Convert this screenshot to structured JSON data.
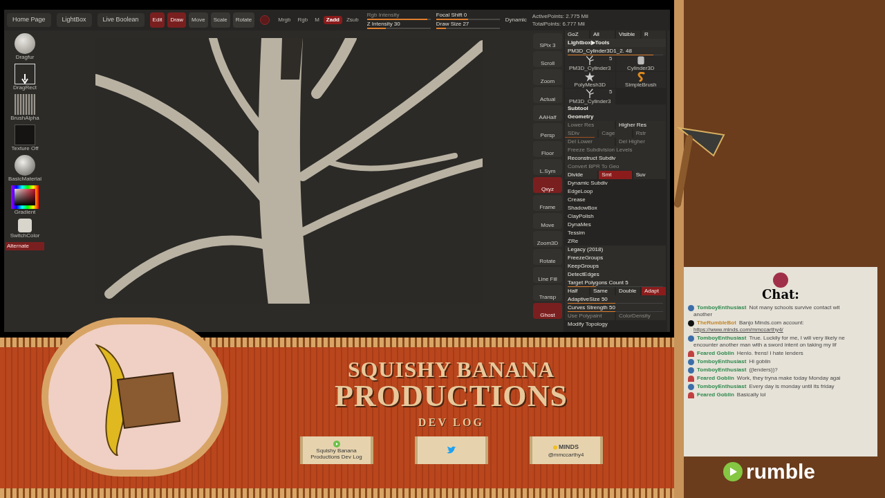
{
  "top_bar": [
    {
      "kind": "tab",
      "label": "Home Page"
    },
    {
      "kind": "tab",
      "label": "LightBox"
    },
    {
      "kind": "tab",
      "label": "Live Boolean"
    },
    {
      "kind": "tool",
      "label": "Edit",
      "selected": true
    },
    {
      "kind": "tool",
      "label": "Draw",
      "selected": true
    },
    {
      "kind": "tool",
      "label": "Move",
      "selected": false
    },
    {
      "kind": "tool",
      "label": "Scale",
      "selected": false
    },
    {
      "kind": "tool",
      "label": "Rotate",
      "selected": false
    },
    {
      "kind": "mode",
      "label": "Mrgb",
      "selected": false
    },
    {
      "kind": "mode",
      "label": "Rgb",
      "selected": false
    },
    {
      "kind": "mode",
      "label": "M",
      "selected": false
    },
    {
      "kind": "mode",
      "label": "Zadd",
      "selected": true
    },
    {
      "kind": "mode",
      "label": "Zsub",
      "selected": false
    },
    {
      "kind": "slider",
      "label": "Rgb Intensity",
      "level": 0.95,
      "disabled": true
    },
    {
      "kind": "slider",
      "label": "Z Intensity 30",
      "level": 0.3,
      "disabled": false
    },
    {
      "kind": "slider",
      "label": "Focal Shift 0",
      "level": 0.5,
      "disabled": false
    },
    {
      "kind": "slider",
      "label": "Draw Size 27",
      "level": 0.15,
      "disabled": false
    },
    {
      "kind": "tab",
      "label": "Dynamic"
    },
    {
      "kind": "stat",
      "label": "ActivePoints: 2.775 Mil"
    },
    {
      "kind": "stat",
      "label": "TotalPoints: 6.777 Mil"
    }
  ],
  "shelf": [
    {
      "kind": "brush",
      "label": "Dragfur"
    },
    {
      "kind": "stroke",
      "label": "DragRect"
    },
    {
      "kind": "alpha",
      "label": "BrushAlpha"
    },
    {
      "kind": "texture",
      "label": "Texture Off"
    },
    {
      "kind": "material",
      "label": "BasicMaterial"
    },
    {
      "kind": "color",
      "label": "Gradient"
    },
    {
      "kind": "swatch",
      "label": "SwitchColor"
    },
    {
      "kind": "button",
      "label": "Alternate",
      "selected": true
    }
  ],
  "right_icons": [
    {
      "label": "SPix 3",
      "selected": false
    },
    {
      "label": "Scroll",
      "selected": false
    },
    {
      "label": "Zoom",
      "selected": false
    },
    {
      "label": "Actual",
      "selected": false
    },
    {
      "label": "AAHalf",
      "selected": false
    },
    {
      "label": "Persp",
      "selected": false
    },
    {
      "label": "Floor",
      "selected": false
    },
    {
      "label": "L.Sym",
      "selected": false
    },
    {
      "label": "Qxyz",
      "selected": true
    },
    {
      "label": "Frame",
      "selected": false
    },
    {
      "label": "Move",
      "selected": false
    },
    {
      "label": "Zoom3D",
      "selected": false
    },
    {
      "label": "Rotate",
      "selected": false
    },
    {
      "label": "Line Fill",
      "selected": false
    },
    {
      "label": "Transp",
      "selected": false
    },
    {
      "label": "Ghost",
      "selected": true
    }
  ],
  "tool_panel": [
    {
      "kind": "buttons",
      "items": [
        {
          "label": "GoZ",
          "selected": false,
          "disabled": false
        },
        {
          "label": "All",
          "selected": false,
          "disabled": false
        },
        {
          "label": "Visible",
          "selected": false,
          "disabled": false
        },
        {
          "label": "R",
          "selected": false,
          "disabled": false
        }
      ]
    },
    {
      "kind": "title",
      "label": "Lightbox▶Tools"
    },
    {
      "kind": "slider",
      "label": "PM3D_Cylinder3D1_2. 48",
      "level": 0.9,
      "disabled": false
    },
    {
      "kind": "thumbs",
      "items": [
        {
          "kind": "tree",
          "label": "PM3D_Cylinder3",
          "count": "5"
        },
        {
          "kind": "cylinder",
          "label": "Cylinder3D"
        },
        {
          "kind": "star",
          "label": "PolyMesh3D"
        },
        {
          "kind": "brush",
          "label": "SimpleBrush"
        },
        {
          "kind": "tree",
          "label": "PM3D_Cylinder3",
          "count": "5"
        }
      ]
    },
    {
      "kind": "section",
      "label": "Subtool"
    },
    {
      "kind": "section",
      "label": "Geometry"
    },
    {
      "kind": "buttons",
      "items": [
        {
          "label": "Lower Res",
          "selected": false,
          "disabled": true
        },
        {
          "label": "Higher Res",
          "selected": false,
          "disabled": false
        }
      ]
    },
    {
      "kind": "buttons",
      "items": [
        {
          "label": "SDiv",
          "selected": false,
          "disabled": true,
          "level": 0.9
        },
        {
          "label": "Cage",
          "selected": false,
          "disabled": true
        },
        {
          "label": "Rstr",
          "selected": false,
          "disabled": true
        }
      ]
    },
    {
      "kind": "buttons",
      "items": [
        {
          "label": "Del Lower",
          "selected": false,
          "disabled": true
        },
        {
          "label": "Del Higher",
          "selected": false,
          "disabled": true
        }
      ]
    },
    {
      "kind": "buttons",
      "items": [
        {
          "label": "Freeze Subdivision Levels",
          "selected": false,
          "disabled": true
        }
      ]
    },
    {
      "kind": "buttons",
      "items": [
        {
          "label": "Reconstruct Subdiv",
          "selected": false,
          "disabled": false
        }
      ]
    },
    {
      "kind": "buttons",
      "items": [
        {
          "label": "Convert BPR To Geo",
          "selected": false,
          "disabled": true
        }
      ]
    },
    {
      "kind": "buttons",
      "items": [
        {
          "label": "Divide",
          "selected": false,
          "disabled": false
        },
        {
          "label": "Smt",
          "selected": true,
          "disabled": false
        },
        {
          "label": "Suv",
          "selected": false,
          "disabled": false
        }
      ]
    },
    {
      "kind": "sub",
      "label": "Dynamic Subdiv"
    },
    {
      "kind": "sub",
      "label": "EdgeLoop"
    },
    {
      "kind": "sub",
      "label": "Crease"
    },
    {
      "kind": "sub",
      "label": "ShadowBox"
    },
    {
      "kind": "sub",
      "label": "ClayPolish"
    },
    {
      "kind": "sub",
      "label": "DynaMes"
    },
    {
      "kind": "sub",
      "label": "Tessim"
    },
    {
      "kind": "sub",
      "label": "ZRe"
    },
    {
      "kind": "buttons",
      "items": [
        {
          "label": "Legacy (2018)",
          "selected": false,
          "disabled": false
        }
      ]
    },
    {
      "kind": "buttons",
      "items": [
        {
          "label": "FreezeGroups",
          "selected": false,
          "disabled": false
        }
      ]
    },
    {
      "kind": "buttons",
      "items": [
        {
          "label": "KeepGroups",
          "selected": false,
          "disabled": false
        }
      ]
    },
    {
      "kind": "buttons",
      "items": [
        {
          "label": "DetectEdges",
          "selected": false,
          "disabled": false
        }
      ]
    },
    {
      "kind": "slider",
      "label": "Target Polygons Count 5",
      "level": 0.3,
      "disabled": false
    },
    {
      "kind": "buttons",
      "items": [
        {
          "label": "Half",
          "selected": false,
          "disabled": false
        },
        {
          "label": "Same",
          "selected": false,
          "disabled": false
        },
        {
          "label": "Double",
          "selected": false,
          "disabled": false
        },
        {
          "label": "Adapt",
          "selected": true,
          "disabled": false
        }
      ]
    },
    {
      "kind": "slider",
      "label": "AdaptiveSize 50",
      "level": 0.5,
      "disabled": false
    },
    {
      "kind": "slider",
      "label": "Curves Strength 50",
      "level": 0.5,
      "disabled": false
    },
    {
      "kind": "buttons",
      "items": [
        {
          "label": "Use Polypaint",
          "selected": false,
          "disabled": true
        },
        {
          "label": "ColorDensity",
          "selected": false,
          "disabled": true
        }
      ]
    },
    {
      "kind": "sub",
      "label": "Modify Topology"
    }
  ],
  "banner": {
    "title_1": "SQUISHY BANANA",
    "title_2": "PRODUCTIONS",
    "subtitle": "DEV LOG",
    "links": [
      {
        "kind": "rumble",
        "label": "Squishy Banana Productions Dev Log"
      },
      {
        "kind": "twitter"
      },
      {
        "kind": "minds",
        "logo": "MINDS",
        "label": "@mmccarthy4"
      }
    ]
  },
  "chat": {
    "title": "Chat:",
    "messages": [
      {
        "kind": "globe",
        "user": "TomboyEnthusiast",
        "color": "#2f8a4e",
        "lines": [
          "Not many schools survive contact wit",
          "another"
        ]
      },
      {
        "kind": "bot",
        "user": "TheRumbleBot",
        "color": "#c0862c",
        "lines": [
          "Banjo Minds.com account:"
        ],
        "link": "https://www.minds.com/mmccarthy4/"
      },
      {
        "kind": "globe",
        "user": "TomboyEnthusiast",
        "color": "#2f8a4e",
        "lines": [
          "True. Luckily for me, I will very likely ne",
          "encounter another man with a sword intent on taking my lif"
        ]
      },
      {
        "kind": "goblin",
        "user": "Feared Goblin",
        "color": "#2f8a4e",
        "lines": [
          "Henlo. frens! I hate lenders"
        ]
      },
      {
        "kind": "globe",
        "user": "TomboyEnthusiast",
        "color": "#2f8a4e",
        "lines": [
          "Hi goblin"
        ]
      },
      {
        "kind": "globe",
        "user": "TomboyEnthusiast",
        "color": "#2f8a4e",
        "lines": [
          "((lenders))?"
        ]
      },
      {
        "kind": "goblin",
        "user": "Feared Goblin",
        "color": "#2f8a4e",
        "lines": [
          "Work, they tryna make today Monday agai"
        ]
      },
      {
        "kind": "globe",
        "user": "TomboyEnthusiast",
        "color": "#2f8a4e",
        "lines": [
          "Every day is monday until its friday"
        ]
      },
      {
        "kind": "goblin",
        "user": "Feared Goblin",
        "color": "#2f8a4e",
        "lines": [
          "Basically lol"
        ]
      }
    ]
  },
  "brand": {
    "wordmark": "rumble"
  }
}
